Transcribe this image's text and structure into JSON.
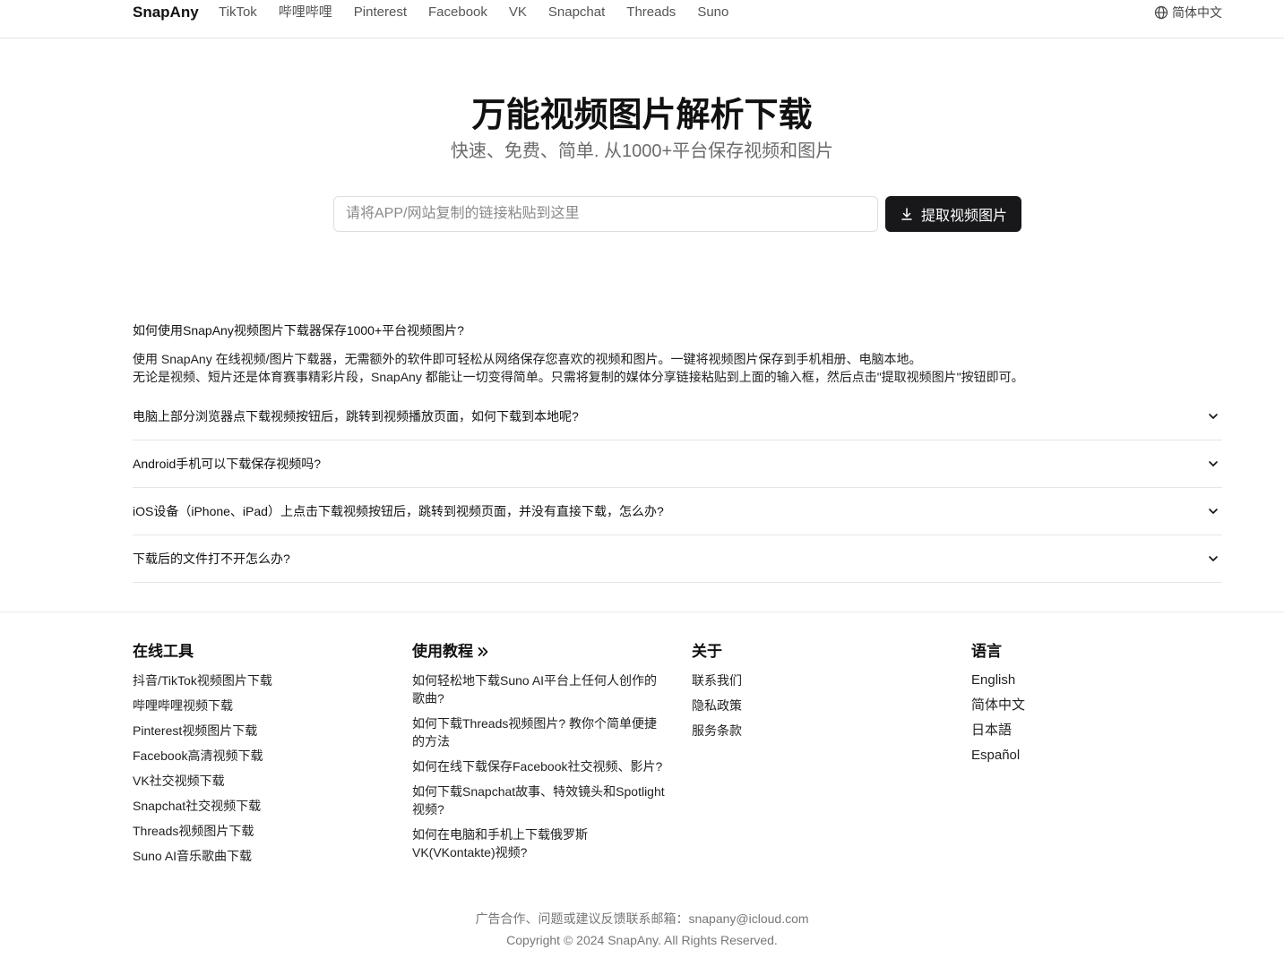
{
  "nav": {
    "brand": "SnapAny",
    "links": [
      "TikTok",
      "哔哩哔哩",
      "Pinterest",
      "Facebook",
      "VK",
      "Snapchat",
      "Threads",
      "Suno"
    ],
    "language": "简体中文"
  },
  "hero": {
    "title": "万能视频图片解析下载",
    "subtitle": "快速、免费、简单. 从1000+平台保存视频和图片",
    "input_placeholder": "请将APP/网站复制的链接粘贴到这里",
    "button_label": "提取视频图片"
  },
  "faq": {
    "open_question": "如何使用SnapAny视频图片下载器保存1000+平台视频图片?",
    "open_answer_lines": [
      "使用 SnapAny 在线视频/图片下载器，无需额外的软件即可轻松从网络保存您喜欢的视频和图片。一键将视频图片保存到手机相册、电脑本地。",
      "无论是视频、短片还是体育赛事精彩片段，SnapAny 都能让一切变得简单。只需将复制的媒体分享链接粘贴到上面的输入框，然后点击\"提取视频图片\"按钮即可。"
    ],
    "items": [
      "电脑上部分浏览器点下载视频按钮后，跳转到视频播放页面，如何下载到本地呢?",
      "Android手机可以下载保存视频吗?",
      "iOS设备（iPhone、iPad）上点击下载视频按钮后，跳转到视频页面，并没有直接下载，怎么办?",
      "下载后的文件打不开怎么办?"
    ]
  },
  "footer": {
    "tools": {
      "title": "在线工具",
      "items": [
        "抖音/TikTok视频图片下载",
        "哔哩哔哩视频下载",
        "Pinterest视频图片下载",
        "Facebook高清视频下载",
        "VK社交视频下载",
        "Snapchat社交视频下载",
        "Threads视频图片下载",
        "Suno AI音乐歌曲下载"
      ]
    },
    "tutorials": {
      "title": "使用教程",
      "items": [
        "如何轻松地下载Suno AI平台上任何人创作的歌曲?",
        "如何下载Threads视频图片? 教你个简单便捷的方法",
        "如何在线下载保存Facebook社交视频、影片?",
        "如何下载Snapchat故事、特效镜头和Spotlight视频?",
        "如何在电脑和手机上下载俄罗斯VK(VKontakte)视频?"
      ]
    },
    "about": {
      "title": "关于",
      "items": [
        "联系我们",
        "隐私政策",
        "服务条款"
      ]
    },
    "languages": {
      "title": "语言",
      "items": [
        "English",
        "简体中文",
        "日本語",
        "Español"
      ]
    },
    "contact": "广告合作、问题或建议反馈联系邮箱：snapany@icloud.com",
    "copyright": "Copyright © 2024 SnapAny. All Rights Reserved."
  }
}
